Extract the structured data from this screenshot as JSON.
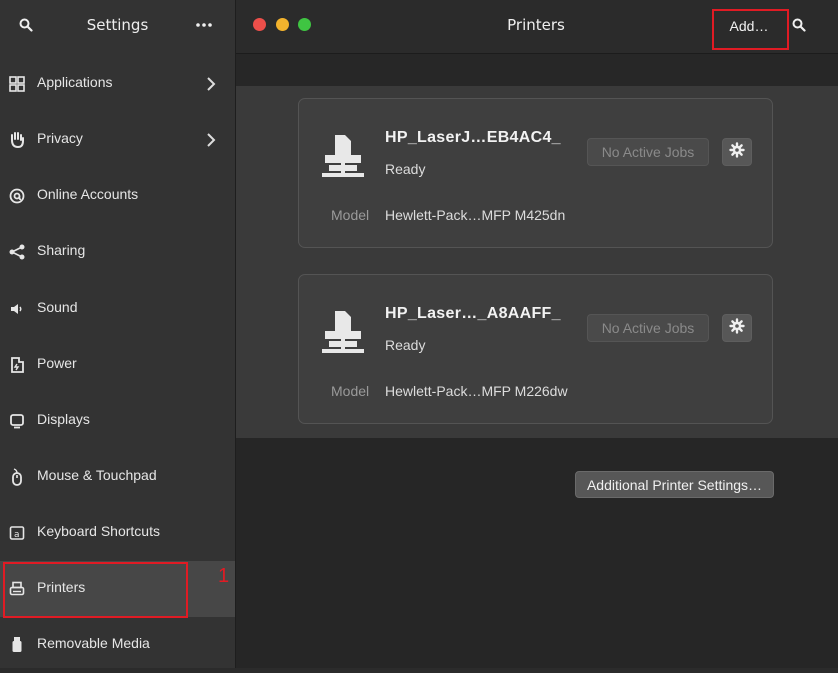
{
  "sidebar": {
    "title": "Settings",
    "items": [
      {
        "label": "Applications",
        "icon": "applications-icon",
        "chevron": true
      },
      {
        "label": "Privacy",
        "icon": "privacy-hand-icon",
        "chevron": true
      },
      {
        "label": "Online Accounts",
        "icon": "at-sign-icon",
        "chevron": false
      },
      {
        "label": "Sharing",
        "icon": "share-icon",
        "chevron": false
      },
      {
        "label": "Sound",
        "icon": "speaker-icon",
        "chevron": false
      },
      {
        "label": "Power",
        "icon": "power-plug-icon",
        "chevron": false
      },
      {
        "label": "Displays",
        "icon": "display-icon",
        "chevron": false
      },
      {
        "label": "Mouse & Touchpad",
        "icon": "mouse-icon",
        "chevron": false
      },
      {
        "label": "Keyboard Shortcuts",
        "icon": "keyboard-icon",
        "chevron": false
      },
      {
        "label": "Printers",
        "icon": "printer-icon",
        "chevron": false,
        "active": true
      },
      {
        "label": "Removable Media",
        "icon": "usb-drive-icon",
        "chevron": false
      }
    ]
  },
  "header": {
    "title": "Printers",
    "add_label": "Add…"
  },
  "annotations": {
    "first": "1",
    "second": "2",
    "color": "#e01b24"
  },
  "printers": [
    {
      "name": "HP_LaserJ…EB4AC4_",
      "status": "Ready",
      "model_label": "Model",
      "model": "Hewlett-Pack…MFP M425dn",
      "jobs_label": "No Active Jobs"
    },
    {
      "name": "HP_Laser…_A8AAFF_",
      "status": "Ready",
      "model_label": "Model",
      "model": "Hewlett-Pack…MFP M226dw",
      "jobs_label": "No Active Jobs"
    }
  ],
  "footer": {
    "additional_label": "Additional Printer Settings…"
  }
}
